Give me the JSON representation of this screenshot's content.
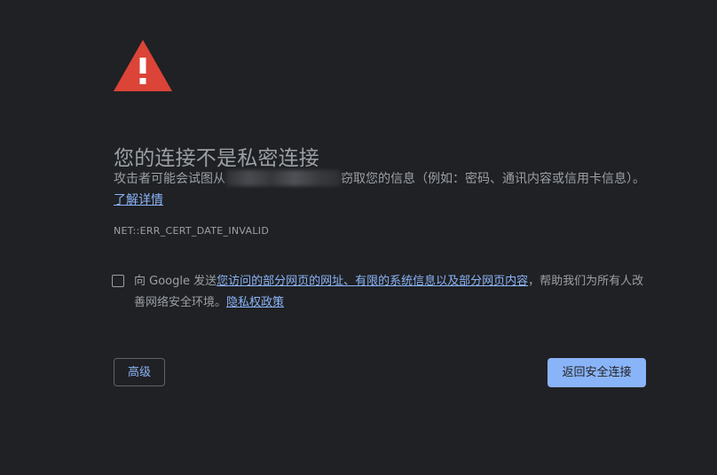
{
  "interstitial": {
    "icon": "warning-triangle-icon",
    "title": "您的连接不是私密连接",
    "description": {
      "before_blur": "攻击者可能会试图从",
      "after_blur": "窃取您的信息（例如：密码、通讯内容或信用卡信息）。",
      "learn_more_link": "了解详情"
    },
    "error_code": "NET::ERR_CERT_DATE_INVALID",
    "report_opt_in": {
      "checked": false,
      "text_prefix": "向 Google 发送",
      "link_text": "您访问的部分网页的网址、有限的系统信息以及部分网页内容",
      "text_middle": "，帮助我们为所有人改善网络安全环境。",
      "privacy_link": "隐私权政策"
    },
    "buttons": {
      "advanced": "高级",
      "back_to_safety": "返回安全连接"
    }
  },
  "colors": {
    "background": "#202124",
    "text": "#9aa0a6",
    "link": "#8ab4f8",
    "warning_red": "#db4437",
    "primary_button_bg": "#8ab4f8"
  }
}
